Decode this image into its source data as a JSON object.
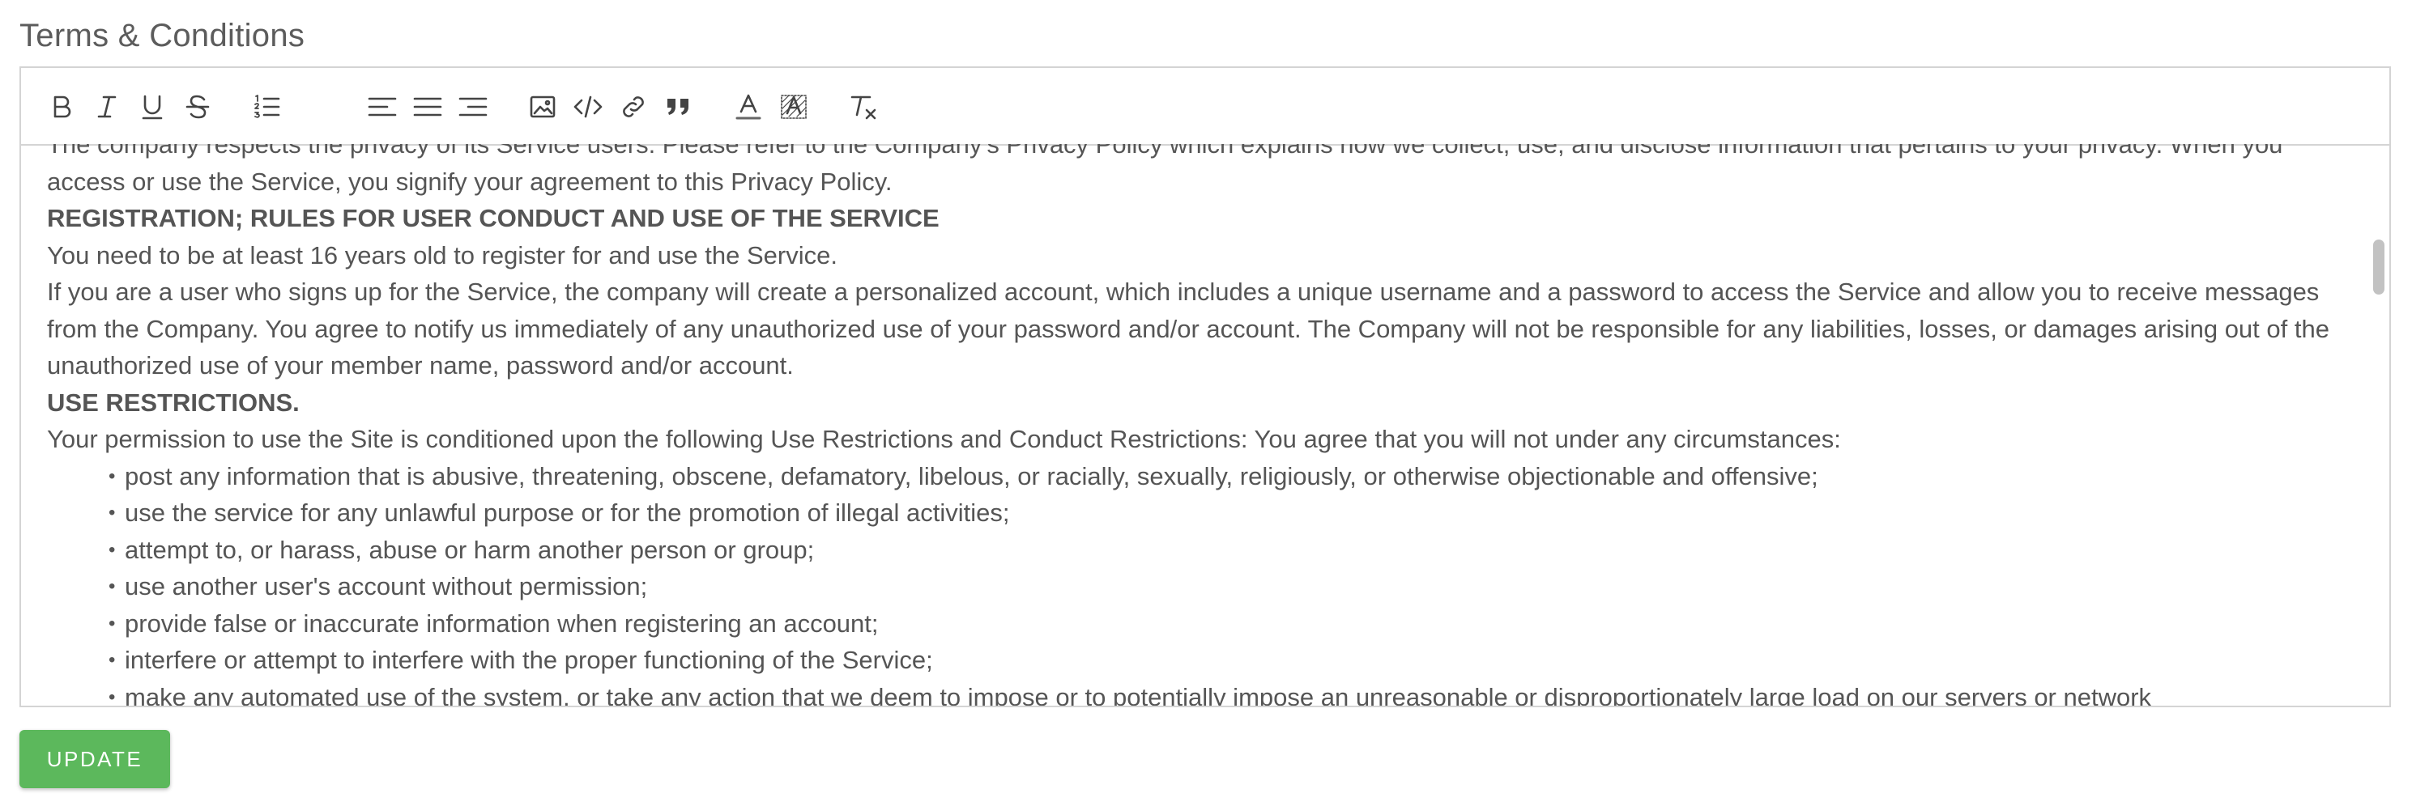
{
  "section_title": "Terms & Conditions",
  "toolbar": {
    "bold": "B",
    "italic": "I",
    "underline": "U",
    "strike": "S",
    "font_color": "A",
    "bg_color": "A"
  },
  "content": {
    "privacy_line": "The company respects the privacy of its Service users. Please refer to the Company's Privacy Policy which explains how we collect, use, and disclose information that pertains to your privacy. When you access or use the Service, you signify your agreement to this Privacy Policy.",
    "heading_registration": "REGISTRATION; RULES FOR USER CONDUCT AND USE OF THE SERVICE",
    "age_line": "You need to be at least 16 years old to register for and use the Service.",
    "account_para": "If you are a user who signs up for the Service, the company will create a personalized account, which includes a unique username and a password to access the Service and allow you to receive messages from the Company. You agree to notify us immediately of any unauthorized use of your password and/or account. The Company will not be responsible for any liabilities, losses, or damages arising out of the unauthorized use of your member name, password and/or account.",
    "heading_restrictions": "USE RESTRICTIONS.",
    "restrictions_intro": "Your permission to use the Site is conditioned upon the following Use Restrictions and Conduct Restrictions: You agree that you will not under any circumstances:",
    "bullets": [
      "post any information that is abusive, threatening, obscene, defamatory, libelous, or racially, sexually, religiously, or otherwise objectionable and offensive;",
      "use the service for any unlawful purpose or for the promotion of illegal activities;",
      "attempt to, or harass, abuse or harm another person or group;",
      "use another user's account without permission;",
      "provide false or inaccurate information when registering an account;",
      "interfere or attempt to interfere with the proper functioning of the Service;",
      "make any automated use of the system, or take any action that we deem to impose or to potentially impose an unreasonable or disproportionately large load on our servers or network"
    ]
  },
  "update_button": "UPDATE",
  "colors": {
    "button": "#5cb85c",
    "text": "#555555",
    "border": "#d4d4d4"
  },
  "icons": [
    "bold-icon",
    "italic-icon",
    "underline-icon",
    "strikethrough-icon",
    "ordered-list-icon",
    "align-left-icon",
    "align-center-icon",
    "align-right-icon",
    "image-icon",
    "code-icon",
    "link-icon",
    "quote-icon",
    "font-color-icon",
    "background-color-icon",
    "clear-format-icon"
  ]
}
